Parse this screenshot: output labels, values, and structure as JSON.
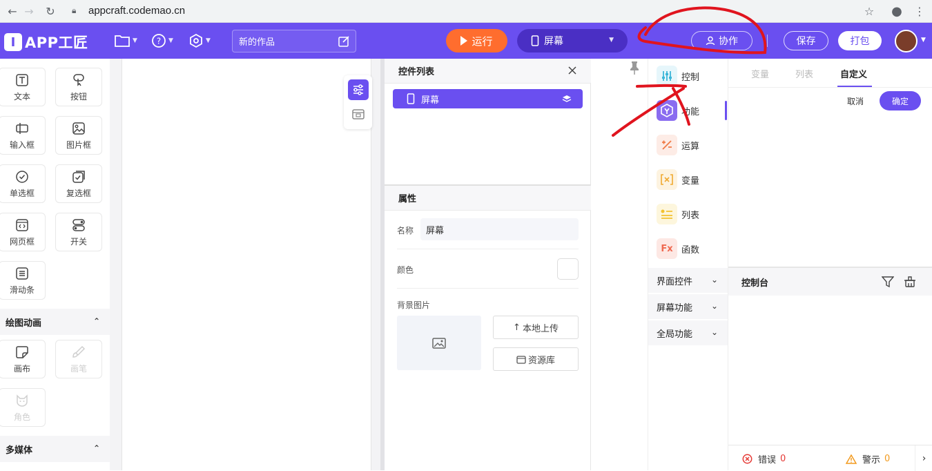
{
  "browser": {
    "url": "appcraft.codemao.cn"
  },
  "header": {
    "logo_text": "APP工匠",
    "project_name": "新的作品",
    "run_label": "运行",
    "screen_select": "屏幕",
    "collab_label": "协作",
    "save_label": "保存",
    "pack_label": "打包"
  },
  "widgets": [
    {
      "label": "文本",
      "icon": "text-icon"
    },
    {
      "label": "按钮",
      "icon": "button-icon"
    },
    {
      "label": "输入框",
      "icon": "input-icon"
    },
    {
      "label": "图片框",
      "icon": "image-icon"
    },
    {
      "label": "单选框",
      "icon": "radio-icon"
    },
    {
      "label": "复选框",
      "icon": "checkbox-icon"
    },
    {
      "label": "网页框",
      "icon": "webview-icon"
    },
    {
      "label": "开关",
      "icon": "switch-icon"
    },
    {
      "label": "滑动条",
      "icon": "slider-icon"
    }
  ],
  "sections": {
    "drawing": "绘图动画",
    "media": "多媒体"
  },
  "drawing_widgets": [
    {
      "label": "画布",
      "icon": "canvas-icon"
    },
    {
      "label": "画笔",
      "icon": "brush-icon"
    },
    {
      "label": "角色",
      "icon": "sprite-icon"
    }
  ],
  "component_list": {
    "title": "控件列表",
    "items": [
      {
        "label": "屏幕"
      }
    ]
  },
  "properties": {
    "title": "属性",
    "name_label": "名称",
    "name_value": "屏幕",
    "color_label": "颜色",
    "bg_label": "背景图片",
    "upload_label": "本地上传",
    "library_label": "资源库"
  },
  "block_categories": [
    {
      "label": "控制",
      "icon": "control-icon",
      "bg": "#e6f6fb",
      "fg": "#3bb6d8"
    },
    {
      "label": "功能",
      "icon": "function-icon",
      "bg": "#ece6fc",
      "fg": "#8a6cf0"
    },
    {
      "label": "运算",
      "icon": "math-icon",
      "bg": "#fdece6",
      "fg": "#f07a45"
    },
    {
      "label": "变量",
      "icon": "variable-icon",
      "bg": "#fdf3e0",
      "fg": "#f0a930"
    },
    {
      "label": "列表",
      "icon": "list-icon",
      "bg": "#fdf6dd",
      "fg": "#f2c230"
    },
    {
      "label": "函数",
      "icon": "fx-icon",
      "bg": "#fde8e4",
      "fg": "#ef6950"
    }
  ],
  "block_groups": [
    "界面控件",
    "屏幕功能",
    "全局功能"
  ],
  "right_panel": {
    "tabs": [
      "变量",
      "列表",
      "自定义"
    ],
    "cancel": "取消",
    "confirm": "确定",
    "console_title": "控制台",
    "error_label": "错误",
    "error_count": "0",
    "warn_label": "警示",
    "warn_count": "0"
  },
  "colors": {
    "brand": "#6a4ff0",
    "run": "#ff6d2e",
    "annotation": "#e0141e"
  }
}
